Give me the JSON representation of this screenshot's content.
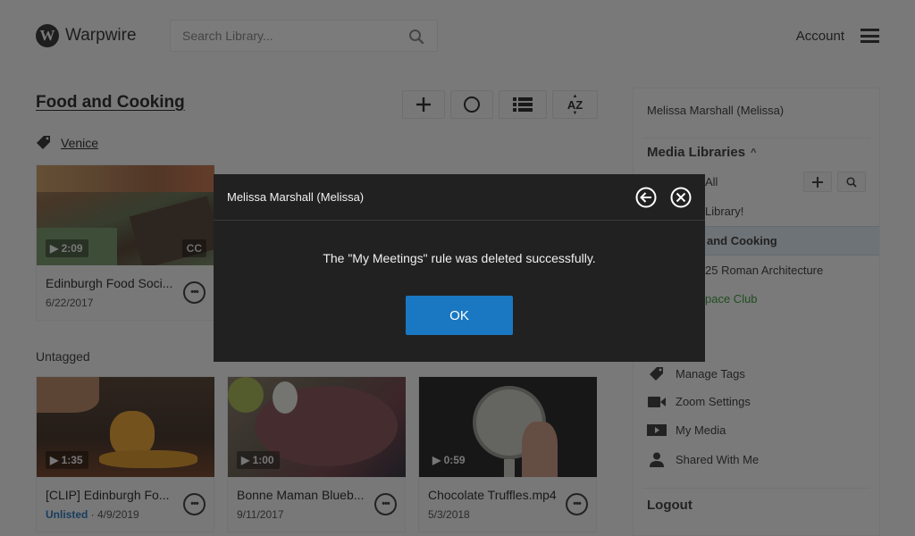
{
  "header": {
    "logo_letter": "W",
    "brand": "Warpwire",
    "search_placeholder": "Search Library...",
    "account_label": "Account"
  },
  "main": {
    "title": "Food and Cooking",
    "toolbar": {
      "add": "+",
      "sort": "AZ"
    },
    "tag_section": {
      "tag_name": "Venice",
      "cards": [
        {
          "duration": "▶ 2:09",
          "cc": "CC",
          "title": "Edinburgh Food Soci...",
          "date": "6/22/2017"
        }
      ]
    },
    "untagged_section": {
      "label": "Untagged",
      "cards": [
        {
          "duration": "▶ 1:35",
          "title": "[CLIP] Edinburgh Fo...",
          "status": "Unlisted",
          "date": " · 4/9/2019"
        },
        {
          "duration": "▶ 1:00",
          "title": "Bonne Maman Blueb...",
          "date": "9/11/2017"
        },
        {
          "duration": "▶ 0:59",
          "title": "Chocolate Truffles.mp4",
          "date": "5/3/2018"
        }
      ]
    },
    "more_label": "•••"
  },
  "sidebar": {
    "user": "Melissa Marshall (Melissa)",
    "libraries_title": "Media Libraries",
    "libraries_caret": "^",
    "libraries": [
      {
        "label": "All"
      },
      {
        "label": "Library!"
      },
      {
        "label": "and Cooking",
        "active": true
      },
      {
        "label": "25 Roman Architecture"
      },
      {
        "label": "pace Club",
        "color": "#3f9b3f"
      }
    ],
    "nav": [
      {
        "label": "Manage Tags",
        "icon": "tag-icon"
      },
      {
        "label": "Zoom Settings",
        "icon": "video-camera-icon"
      },
      {
        "label": "My Media",
        "icon": "play-box-icon"
      },
      {
        "label": "Shared With Me",
        "icon": "person-icon"
      }
    ],
    "logout": "Logout"
  },
  "modal": {
    "title": "Melissa Marshall (Melissa)",
    "message": "The \"My Meetings\" rule was deleted successfully.",
    "ok_label": "OK"
  },
  "colors": {
    "accent": "#1a78c2",
    "modal_bg": "#212121",
    "overlay": "rgba(0,0,0,0.5)",
    "unlisted": "#2f7bbf",
    "active_library_bg": "#dce6ee"
  }
}
